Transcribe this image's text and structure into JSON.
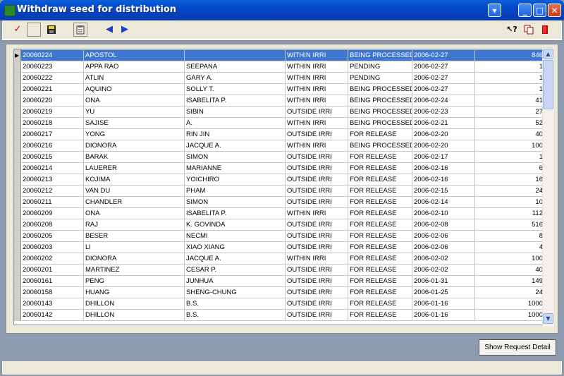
{
  "window": {
    "title": "Withdraw seed for distribution"
  },
  "toolbar": {
    "icons": [
      "check-icon",
      "blank-icon",
      "save-icon",
      "clipboard-icon",
      "prev-arrow-icon",
      "next-arrow-icon",
      "help-icon",
      "copy-icon",
      "exit-icon"
    ]
  },
  "grid": {
    "rows": [
      [
        "20060224",
        "APOSTOL",
        "",
        "WITHIN IRRI",
        "BEING PROCESSED",
        "2006-02-27",
        "846"
      ],
      [
        "20060223",
        "APPA RAO",
        "SEEPANA",
        "WITHIN IRRI",
        "PENDING",
        "2006-02-27",
        "1"
      ],
      [
        "20060222",
        "ATLIN",
        "GARY A.",
        "WITHIN IRRI",
        "PENDING",
        "2006-02-27",
        "1"
      ],
      [
        "20060221",
        "AQUINO",
        "SOLLY T.",
        "WITHIN IRRI",
        "BEING PROCESSED",
        "2006-02-27",
        "1"
      ],
      [
        "20060220",
        "ONA",
        "ISABELITA P.",
        "WITHIN IRRI",
        "BEING PROCESSED",
        "2006-02-24",
        "41"
      ],
      [
        "20060219",
        "YU",
        "SIBIN",
        "OUTSIDE IRRI",
        "BEING PROCESSED",
        "2006-02-23",
        "27"
      ],
      [
        "20060218",
        "SAJISE",
        "A.",
        "WITHIN IRRI",
        "BEING PROCESSED",
        "2006-02-21",
        "52"
      ],
      [
        "20060217",
        "YONG",
        "RIN JIN",
        "OUTSIDE IRRI",
        "FOR RELEASE",
        "2006-02-20",
        "40"
      ],
      [
        "20060216",
        "DIONORA",
        "JACQUE A.",
        "WITHIN IRRI",
        "BEING PROCESSED",
        "2006-02-20",
        "100"
      ],
      [
        "20060215",
        "BARAK",
        "SIMON",
        "OUTSIDE IRRI",
        "FOR RELEASE",
        "2006-02-17",
        "1"
      ],
      [
        "20060214",
        "LAUERER",
        "MARIANNE",
        "OUTSIDE IRRI",
        "FOR RELEASE",
        "2006-02-16",
        "6"
      ],
      [
        "20060213",
        "KOJIMA",
        "YOICHIRO",
        "OUTSIDE IRRI",
        "FOR RELEASE",
        "2006-02-16",
        "16"
      ],
      [
        "20060212",
        "VAN DU",
        "PHAM",
        "OUTSIDE IRRI",
        "FOR RELEASE",
        "2006-02-15",
        "24"
      ],
      [
        "20060211",
        "CHANDLER",
        "SIMON",
        "OUTSIDE IRRI",
        "FOR RELEASE",
        "2006-02-14",
        "10"
      ],
      [
        "20060209",
        "ONA",
        "ISABELITA P.",
        "WITHIN IRRI",
        "FOR RELEASE",
        "2006-02-10",
        "112"
      ],
      [
        "20060208",
        "RAJ",
        "K. GOVINDA",
        "OUTSIDE IRRI",
        "FOR RELEASE",
        "2006-02-08",
        "516"
      ],
      [
        "20060205",
        "BESER",
        "NECMI",
        "OUTSIDE IRRI",
        "FOR RELEASE",
        "2006-02-06",
        "8"
      ],
      [
        "20060203",
        "LI",
        "XIAO XIANG",
        "OUTSIDE IRRI",
        "FOR RELEASE",
        "2006-02-06",
        "4"
      ],
      [
        "20060202",
        "DIONORA",
        "JACQUE A.",
        "WITHIN IRRI",
        "FOR RELEASE",
        "2006-02-02",
        "100"
      ],
      [
        "20060201",
        "MARTINEZ",
        "CESAR P.",
        "OUTSIDE IRRI",
        "FOR RELEASE",
        "2006-02-02",
        "40"
      ],
      [
        "20060161",
        "PENG",
        "JUNHUA",
        "OUTSIDE IRRI",
        "FOR RELEASE",
        "2006-01-31",
        "149"
      ],
      [
        "20060158",
        "HUANG",
        "SHENG-CHUNG",
        "OUTSIDE IRRI",
        "FOR RELEASE",
        "2006-01-25",
        "24"
      ],
      [
        "20060143",
        "DHILLON",
        "B.S.",
        "OUTSIDE IRRI",
        "FOR RELEASE",
        "2006-01-16",
        "1000"
      ],
      [
        "20060142",
        "DHILLON",
        "B.S.",
        "OUTSIDE IRRI",
        "FOR RELEASE",
        "2006-01-16",
        "1000"
      ]
    ],
    "selected_row": 0
  },
  "buttons": {
    "show_detail": "Show Request Detail"
  },
  "colors": {
    "title_bar": "#0a5fd8",
    "selection": "#3e77d0"
  }
}
